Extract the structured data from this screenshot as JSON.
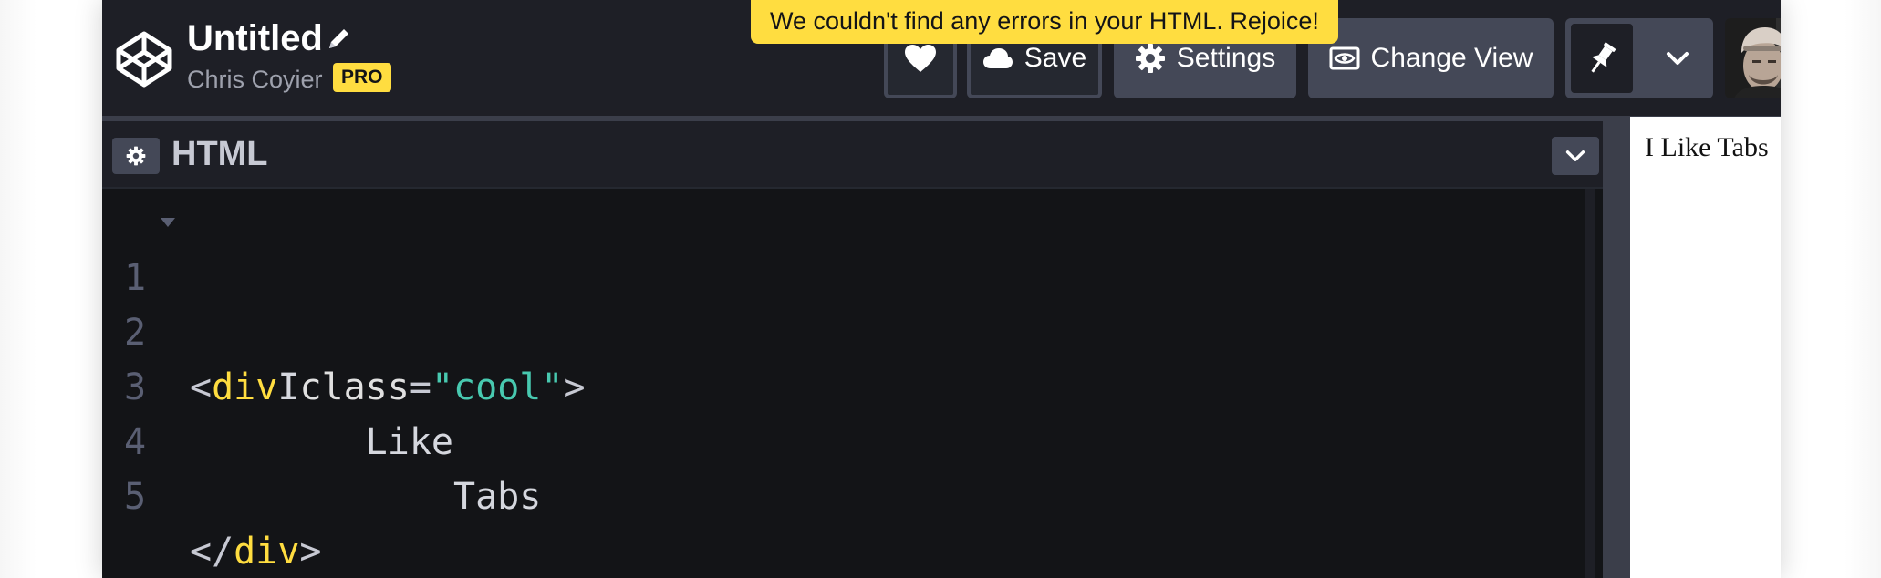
{
  "header": {
    "title": "Untitled",
    "author": "Chris Coyier",
    "badge": "PRO",
    "buttons": {
      "save": "Save",
      "settings": "Settings",
      "change_view": "Change View"
    }
  },
  "toast": {
    "message": "We couldn't find any errors in your HTML. Rejoice!"
  },
  "editor": {
    "title": "HTML",
    "lines": [
      {
        "num": "1"
      },
      {
        "num": "2",
        "text": "    I"
      },
      {
        "num": "3",
        "text": "        Like"
      },
      {
        "num": "4",
        "text": "            Tabs"
      },
      {
        "num": "5"
      }
    ],
    "tokens": {
      "open_lt": "<",
      "open_tag": "div",
      "attr_name": "class",
      "equals": "=",
      "attr_value": "\"cool\"",
      "open_gt": ">",
      "close_lt": "</",
      "close_tag": "div",
      "close_gt": ">"
    }
  },
  "preview": {
    "text": "I Like Tabs"
  },
  "colors": {
    "accent_yellow": "#ffdd40",
    "header_bg": "#1e1f26",
    "editor_bg": "#131417",
    "button_bg": "#444857",
    "string_color": "#48c9b0"
  },
  "icons": {
    "logo": "codepen-logo-icon",
    "pencil": "pencil-icon",
    "heart": "heart-icon",
    "save": "cloud-icon",
    "settings": "gear-icon",
    "change_view": "eye-icon",
    "pin": "pin-icon",
    "dropdown": "chevron-down-icon"
  }
}
